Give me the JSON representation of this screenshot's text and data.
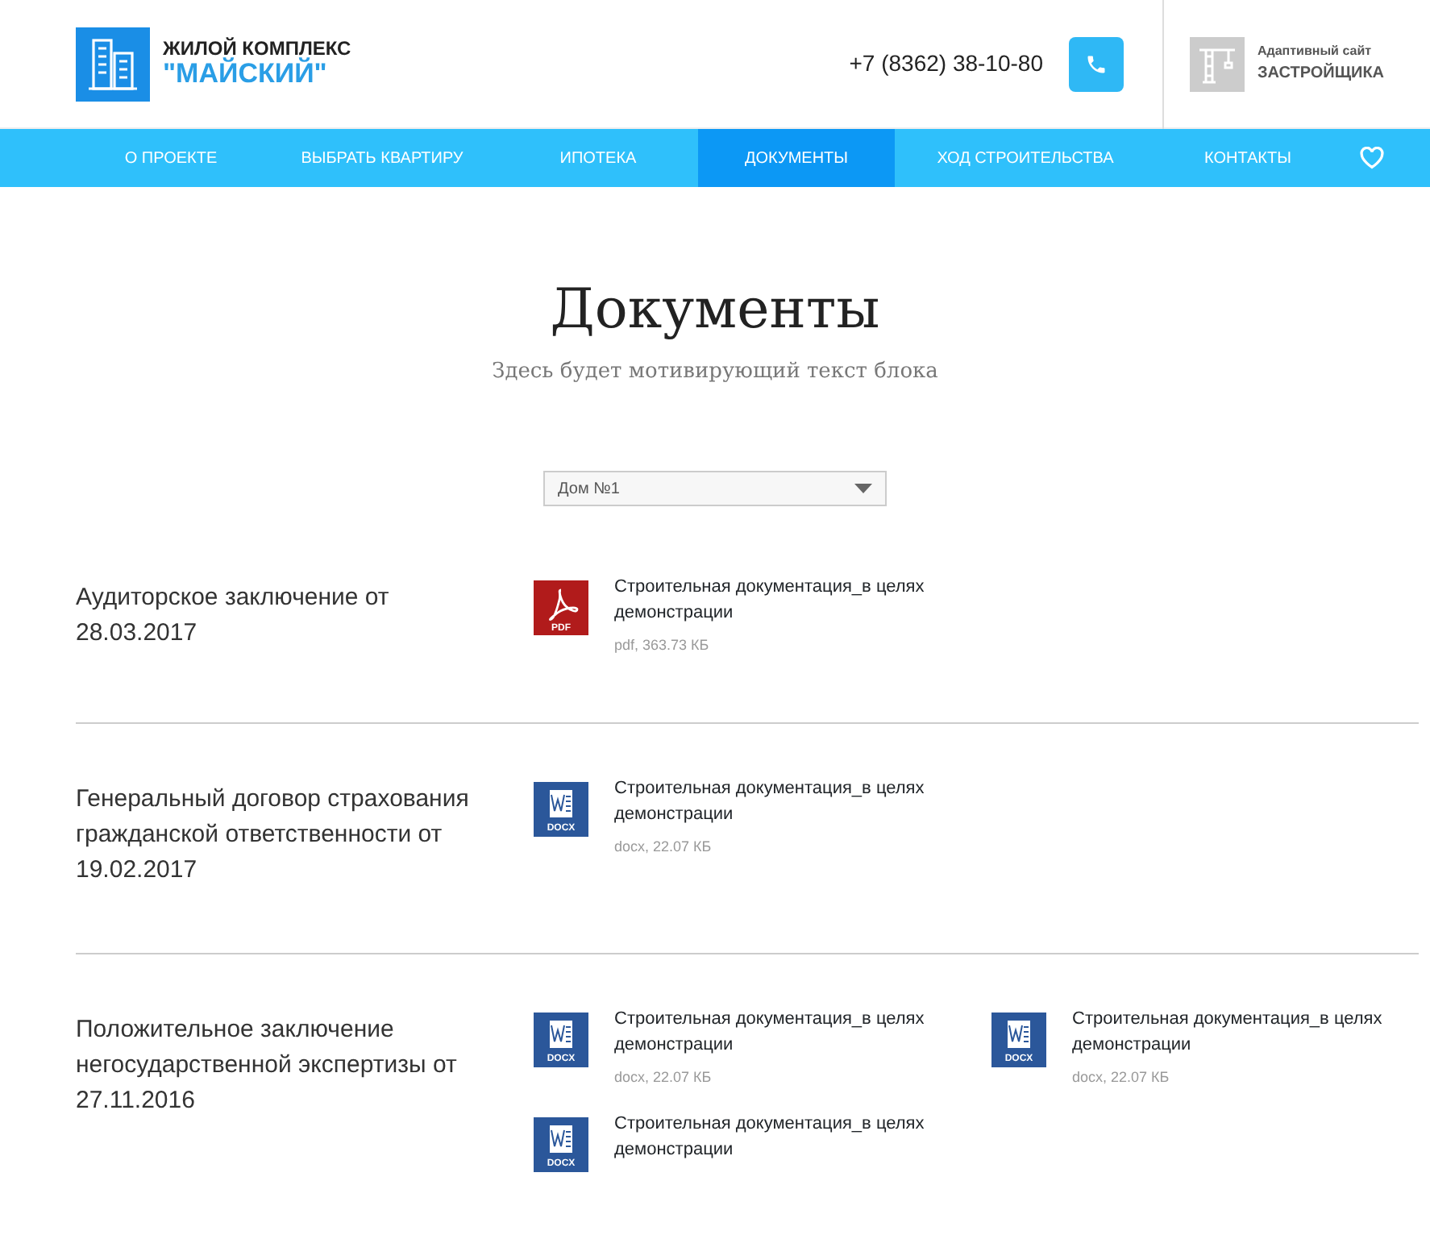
{
  "header": {
    "brand_line1": "ЖИЛОЙ КОМПЛЕКС",
    "brand_line2": "\"МАЙСКИЙ\"",
    "phone": "+7 (8362) 38-10-80",
    "developer_line1": "Адаптивный сайт",
    "developer_line2": "ЗАСТРОЙЩИКА"
  },
  "nav": [
    {
      "label": "О ПРОЕКТЕ",
      "selected": false
    },
    {
      "label": "ВЫБРАТЬ КВАРТИРУ",
      "selected": false
    },
    {
      "label": "ИПОТЕКА",
      "selected": false
    },
    {
      "label": "ДОКУМЕНТЫ",
      "selected": true
    },
    {
      "label": "ХОД СТРОИТЕЛЬСТВА",
      "selected": false
    },
    {
      "label": "КОНТАКТЫ",
      "selected": false
    }
  ],
  "title": "Документы",
  "subtitle": "Здесь будет мотивирующий текст блока",
  "house_select": {
    "value": "Дом №1"
  },
  "sections": [
    {
      "title": "Аудиторское заключение от 28.03.2017",
      "files": [
        {
          "kind": "pdf",
          "badge": "PDF",
          "name": "Строительная документация_в целях демонстрации",
          "meta": "pdf, 363.73 КБ"
        }
      ]
    },
    {
      "title": "Генеральный договор страхования гражданской ответственности от 19.02.2017",
      "files": [
        {
          "kind": "docx",
          "badge": "DOCX",
          "name": "Строительная документация_в целях демонстрации",
          "meta": "docx, 22.07 КБ"
        }
      ]
    },
    {
      "title": "Положительное заключение негосударственной экспертизы от 27.11.2016",
      "files": [
        {
          "kind": "docx",
          "badge": "DOCX",
          "name": "Строительная документация_в целях демонстрации",
          "meta": "docx, 22.07 КБ"
        },
        {
          "kind": "docx",
          "badge": "DOCX",
          "name": "Строительная документация_в целях демонстрации",
          "meta": "docx, 22.07 КБ"
        },
        {
          "kind": "docx",
          "badge": "DOCX",
          "name": "Строительная документация_в целях демонстрации"
        }
      ]
    }
  ]
}
